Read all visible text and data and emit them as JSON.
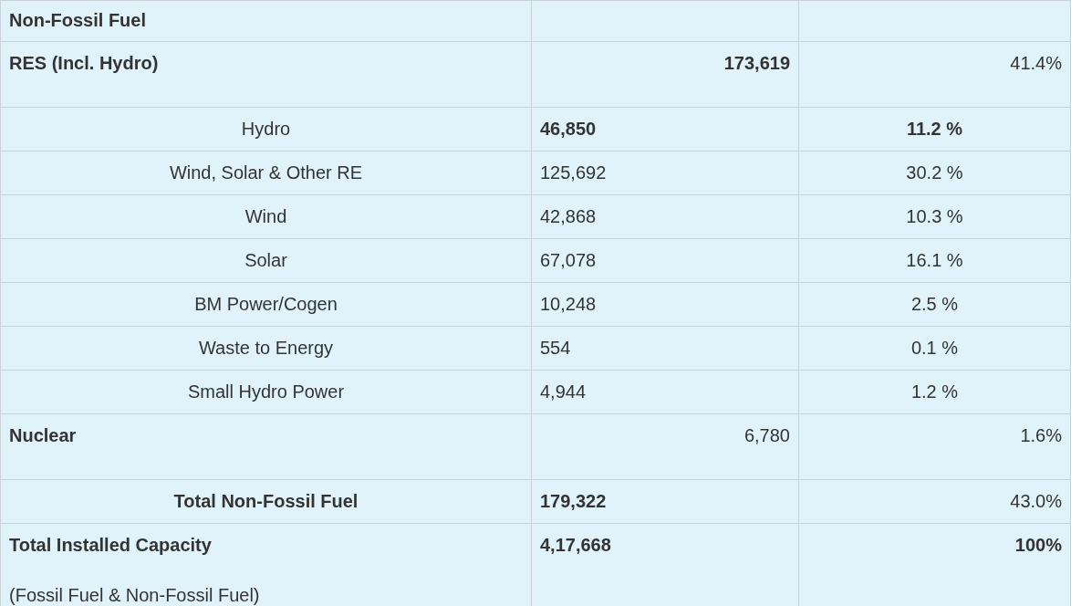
{
  "table": {
    "rows": [
      {
        "kind": "section",
        "label": {
          "text": "Non-Fossil Fuel",
          "bold": true
        }
      },
      {
        "kind": "category",
        "label": {
          "text": "RES (Incl. Hydro)",
          "bold": true
        },
        "value": {
          "text": "173,619",
          "bold": true
        },
        "share": {
          "text": "41.4%",
          "bold": false
        }
      },
      {
        "kind": "item",
        "label": {
          "text": "Hydro",
          "bold": false
        },
        "value": {
          "text": "46,850",
          "bold": true
        },
        "share": {
          "text": "11.2 %",
          "bold": true
        }
      },
      {
        "kind": "item",
        "label": {
          "text": "Wind, Solar & Other RE",
          "bold": false
        },
        "value": {
          "text": "125,692",
          "bold": false
        },
        "share": {
          "text": "30.2 %",
          "bold": false
        }
      },
      {
        "kind": "item",
        "label": {
          "text": "Wind",
          "bold": false
        },
        "value": {
          "text": "42,868",
          "bold": false
        },
        "share": {
          "text": "10.3 %",
          "bold": false
        }
      },
      {
        "kind": "item",
        "label": {
          "text": "Solar",
          "bold": false
        },
        "value": {
          "text": "67,078",
          "bold": false
        },
        "share": {
          "text": "16.1 %",
          "bold": false
        }
      },
      {
        "kind": "item",
        "label": {
          "text": "BM Power/Cogen",
          "bold": false
        },
        "value": {
          "text": "10,248",
          "bold": false
        },
        "share": {
          "text": "2.5 %",
          "bold": false
        }
      },
      {
        "kind": "item",
        "label": {
          "text": "Waste to Energy",
          "bold": false
        },
        "value": {
          "text": "554",
          "bold": false
        },
        "share": {
          "text": "0.1 %",
          "bold": false
        }
      },
      {
        "kind": "item",
        "label": {
          "text": "Small Hydro Power",
          "bold": false
        },
        "value": {
          "text": "4,944",
          "bold": false
        },
        "share": {
          "text": "1.2 %",
          "bold": false
        }
      },
      {
        "kind": "category",
        "label": {
          "text": "Nuclear",
          "bold": true
        },
        "value": {
          "text": "6,780",
          "bold": false
        },
        "share": {
          "text": "1.6%",
          "bold": false
        }
      },
      {
        "kind": "total",
        "label": {
          "text": "Total Non-Fossil Fuel",
          "bold": true
        },
        "value": {
          "text": "179,322",
          "bold": true
        },
        "share": {
          "text": "43.0%",
          "bold": false
        }
      },
      {
        "kind": "grand_total",
        "label": {
          "text": "Total Installed Capacity",
          "bold": true
        },
        "note": "(Fossil Fuel & Non-Fossil Fuel)",
        "value": {
          "text": "4,17,668",
          "bold": true
        },
        "share": {
          "text": "100%",
          "bold": true
        }
      }
    ]
  }
}
